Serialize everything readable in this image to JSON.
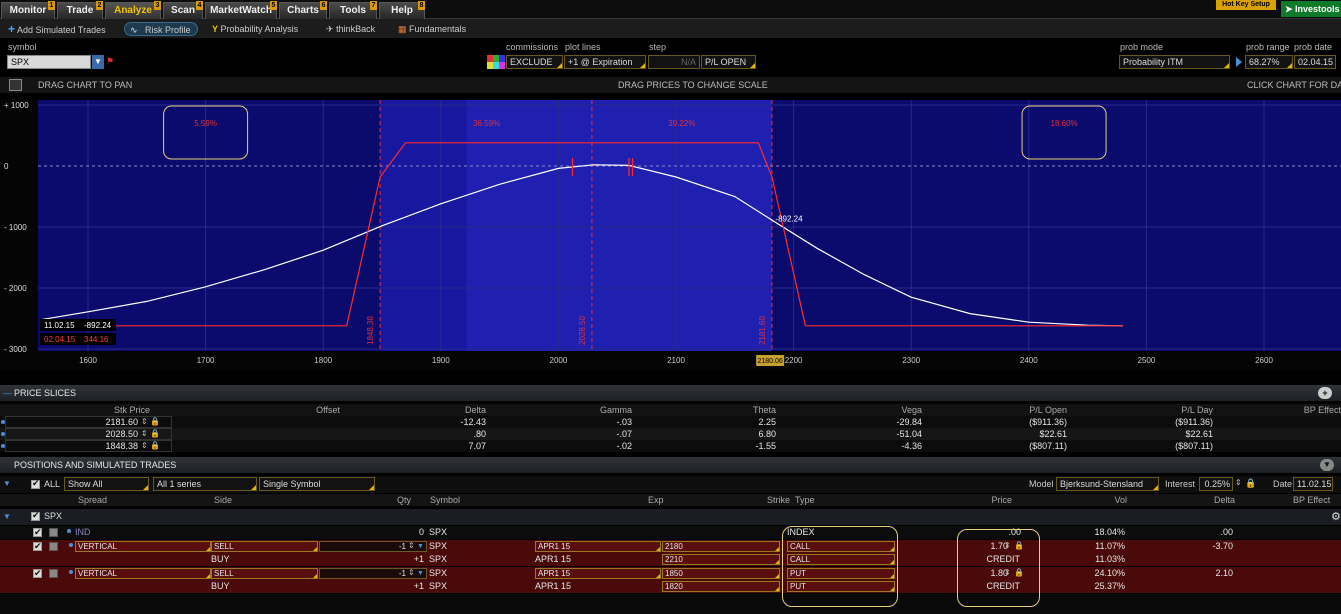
{
  "tabs": [
    {
      "label": "Monitor",
      "hotkey": "1",
      "active": false
    },
    {
      "label": "Trade",
      "hotkey": "2",
      "active": false
    },
    {
      "label": "Analyze",
      "hotkey": "3",
      "active": true
    },
    {
      "label": "Scan",
      "hotkey": "4",
      "active": false
    },
    {
      "label": "MarketWatch",
      "hotkey": "5",
      "active": false
    },
    {
      "label": "Charts",
      "hotkey": "6",
      "active": false
    },
    {
      "label": "Tools",
      "hotkey": "7",
      "active": false
    },
    {
      "label": "Help",
      "hotkey": "8",
      "active": false
    }
  ],
  "hotkey_setup": "Hot Key Setup",
  "investools": "Investools",
  "subtabs": {
    "add_simulated": "Add Simulated Trades",
    "risk_profile": "Risk Profile",
    "probability": "Probability Analysis",
    "thinkback": "thinkBack",
    "fundamentals": "Fundamentals"
  },
  "controls": {
    "symbol_label": "symbol",
    "symbol": "SPX",
    "commissions_label": "commissions",
    "commissions": "EXCLUDE",
    "plot_lines_label": "plot lines",
    "plot_lines": "+1 @ Expiration",
    "step_label": "step",
    "step": "N/A",
    "pl_mode": "P/L OPEN",
    "prob_mode_label": "prob mode",
    "prob_mode": "Probability ITM",
    "prob_range_label": "prob range",
    "prob_range": "68.27%",
    "prob_date_label": "prob date",
    "prob_date": "02.04.15"
  },
  "chart_hints": {
    "pan": "DRAG CHART TO PAN",
    "scale": "DRAG PRICES TO CHANGE SCALE",
    "click": "CLICK CHART FOR DATA"
  },
  "chart_data": {
    "type": "line",
    "xlim": [
      1560,
      1660
    ],
    "ylim": [
      -3000,
      1000
    ],
    "x_ticks": [
      "1600",
      "1700",
      "1800",
      "1900",
      "2000",
      "2100",
      "2200",
      "2300",
      "2400",
      "2500",
      "2600"
    ],
    "x_tick_values": [
      1600,
      1700,
      1800,
      1900,
      2000,
      2100,
      2200,
      2300,
      2400,
      2500,
      2600
    ],
    "y_ticks": [
      "+ 1000",
      "0",
      "- 1000",
      "- 2000",
      "- 3000"
    ],
    "y_tick_values": [
      1000,
      0,
      -1000,
      -2000,
      -3000
    ],
    "probability_labels": [
      {
        "text": "5.59%",
        "boxed": true,
        "x": 1700
      },
      {
        "text": "36.59%",
        "boxed": false,
        "x": 1939
      },
      {
        "text": "39.22%",
        "boxed": false,
        "x": 2105
      },
      {
        "text": "18.60%",
        "boxed": true,
        "x": 2430
      }
    ],
    "strike_lines": [
      {
        "x": 1848.38,
        "label": "1848.38"
      },
      {
        "x": 2028.5,
        "label": "2028.50"
      },
      {
        "x": 2181.6,
        "label": "2181.60"
      }
    ],
    "cursor_price": "2180.06",
    "cursor_x": 2180.06,
    "series": [
      {
        "name": "11.02.15",
        "color": "#ffffff",
        "x": [
          1560,
          1600,
          1650,
          1700,
          1750,
          1800,
          1850,
          1900,
          1950,
          2000,
          2030,
          2060,
          2100,
          2150,
          2182,
          2220,
          2260,
          2300,
          2350,
          2400,
          2450,
          2480
        ],
        "y": [
          -2520,
          -2390,
          -2220,
          -1980,
          -1700,
          -1380,
          -980,
          -620,
          -300,
          -40,
          20,
          10,
          -180,
          -500,
          -892,
          -1350,
          -1780,
          -2150,
          -2420,
          -2560,
          -2610,
          -2620
        ]
      },
      {
        "name": "02.04.15",
        "color": "#ff2a2a",
        "x": [
          1560,
          1820,
          1848.38,
          1870,
          2170,
          2181.6,
          2210,
          2480
        ],
        "y": [
          -2620,
          -2620,
          -180,
          380,
          380,
          -180,
          -2620,
          -2620
        ]
      }
    ],
    "markers": [
      {
        "x": 2012
      },
      {
        "x": 2060
      },
      {
        "x": 2063
      }
    ],
    "cursor_readout": {
      "value": "-892.24"
    },
    "legend_readouts": [
      {
        "date": "11.02.15",
        "value": "-892.24",
        "color": "#ffffff"
      },
      {
        "date": "02.04.15",
        "value": "344.16",
        "color": "#ff3b3b"
      }
    ]
  },
  "price_slices": {
    "title": "PRICE SLICES",
    "headers": [
      "Stk Price",
      "Offset",
      "Delta",
      "Gamma",
      "Theta",
      "Vega",
      "P/L Open",
      "P/L Day",
      "BP Effect"
    ],
    "rows": [
      [
        "2181.60",
        "",
        "-12.43",
        "-.03",
        "2.25",
        "-29.84",
        "($911.36)",
        "($911.36)"
      ],
      [
        "2028.50",
        "",
        ".80",
        "-.07",
        "6.80",
        "-51.04",
        "$22.61",
        "$22.61"
      ],
      [
        "1848.38",
        "",
        "7.07",
        "-.02",
        "-1.55",
        "-4.36",
        "($807.11)",
        "($807.11)"
      ]
    ]
  },
  "positions": {
    "title": "POSITIONS AND SIMULATED TRADES",
    "all_label": "ALL",
    "show": "Show All",
    "series": "All 1 series",
    "symbol_mode": "Single Symbol",
    "model_label": "Model",
    "model": "Bjerksund-Stensland",
    "interest_label": "Interest",
    "interest": "0.25%",
    "date_label": "Date",
    "date": "11.02.15",
    "headers": [
      "Spread",
      "Side",
      "Qty",
      "Symbol",
      "Exp",
      "Strike",
      "Type",
      "Price",
      "Vol",
      "Delta",
      "BP Effect"
    ],
    "group": "SPX",
    "rows": [
      {
        "spread": "IND",
        "side": "",
        "qty": "0",
        "symbol": "SPX",
        "exp": "",
        "strike": "",
        "type": "INDEX",
        "price": ".00",
        "vol": "18.04%",
        "delta": ".00",
        "kind": "ind"
      },
      {
        "spread": "VERTICAL",
        "side": "SELL",
        "qty": "-1",
        "symbol": "SPX",
        "exp": "APR1 15",
        "strike": "2180",
        "type": "CALL",
        "price": "1.70",
        "vol": "11.07%",
        "delta": "-3.70",
        "kind": "lead"
      },
      {
        "spread": "",
        "side": "BUY",
        "qty": "+1",
        "symbol": "SPX",
        "exp": "APR1 15",
        "strike": "2210",
        "type": "CALL",
        "price": "CREDIT",
        "vol": "11.03%",
        "delta": "",
        "kind": "leg"
      },
      {
        "spread": "VERTICAL",
        "side": "SELL",
        "qty": "-1",
        "symbol": "SPX",
        "exp": "APR1 15",
        "strike": "1850",
        "type": "PUT",
        "price": "1.80",
        "vol": "24.10%",
        "delta": "2.10",
        "kind": "lead"
      },
      {
        "spread": "",
        "side": "BUY",
        "qty": "+1",
        "symbol": "SPX",
        "exp": "APR1 15",
        "strike": "1820",
        "type": "PUT",
        "price": "CREDIT",
        "vol": "25.37%",
        "delta": "",
        "kind": "leg"
      }
    ]
  }
}
